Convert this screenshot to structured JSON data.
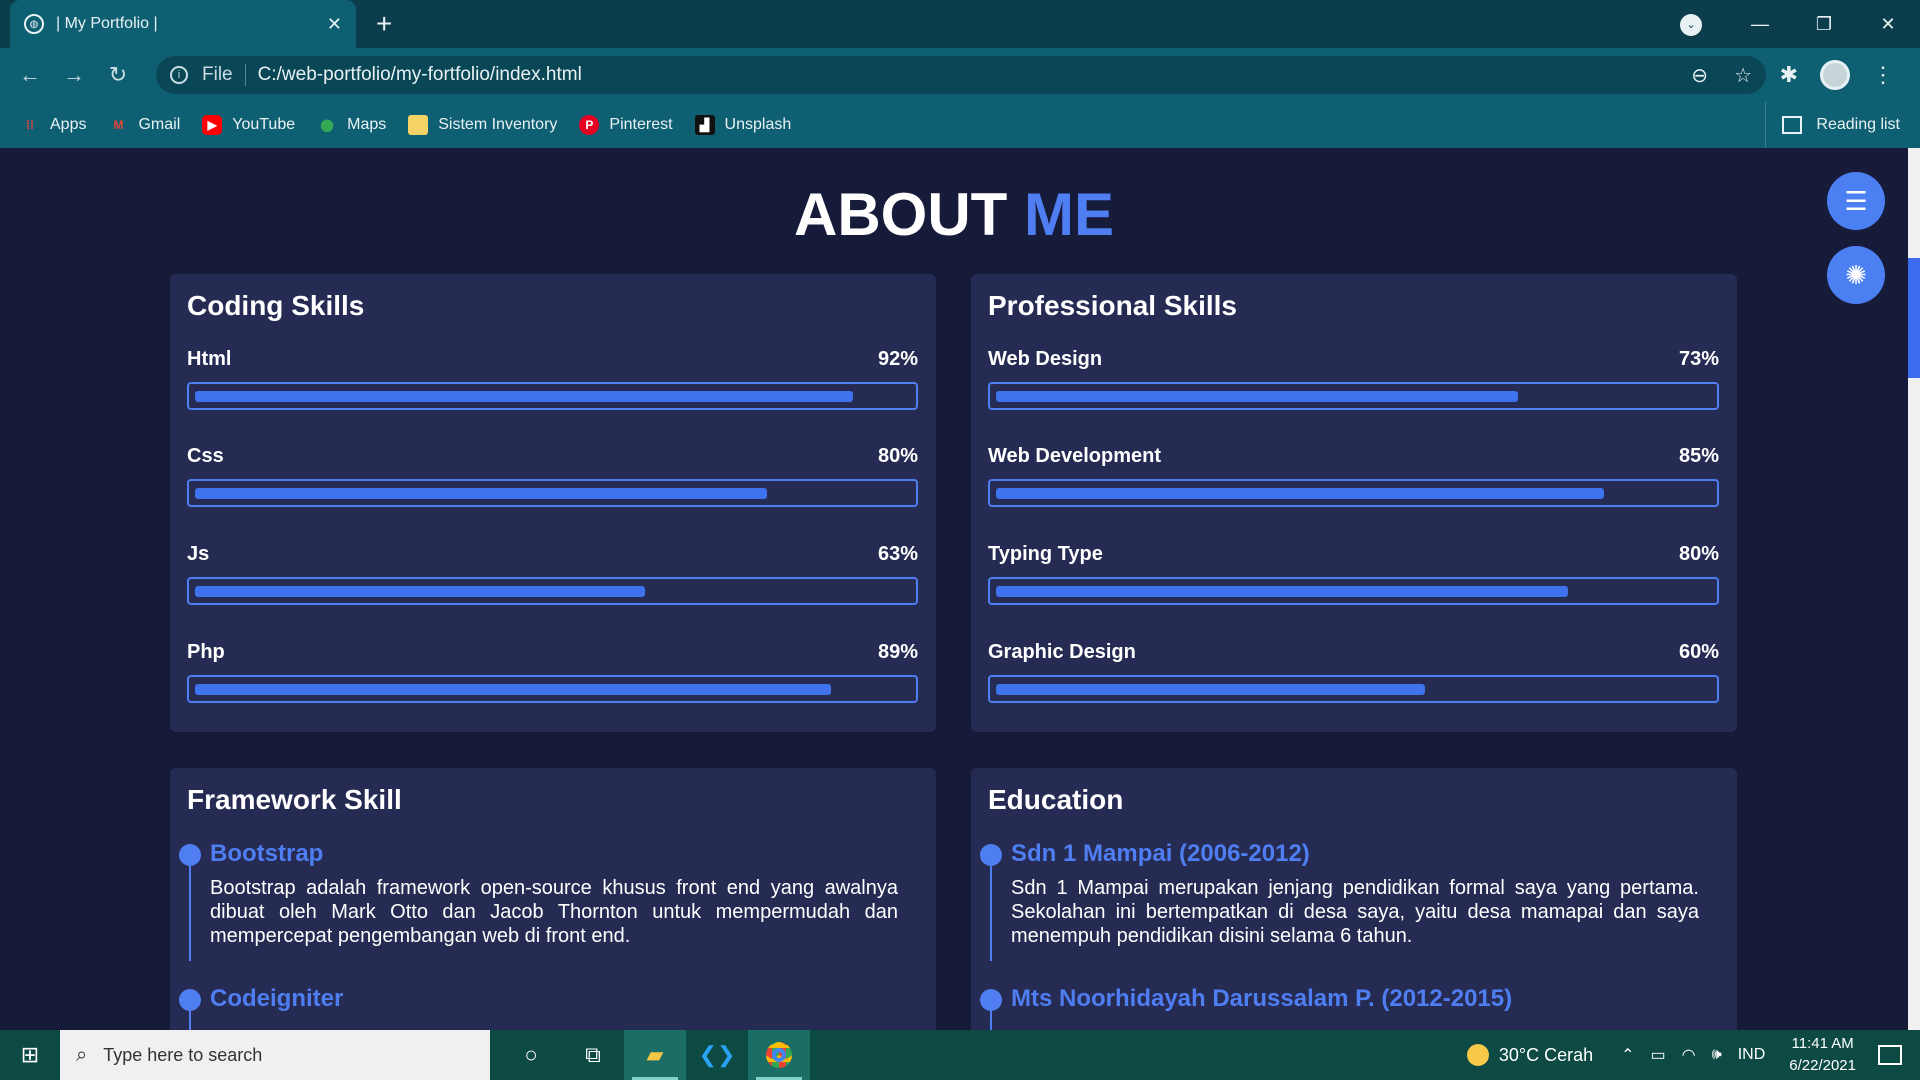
{
  "browser": {
    "tab_title": "| My Portfolio |",
    "tab_close": "✕",
    "new_tab": "+",
    "url_prefix": "File",
    "url": "C:/web-portfolio/my-fortfolio/index.html",
    "window_controls": [
      "⌄",
      "—",
      "❐",
      "✕"
    ],
    "bookmarks": [
      {
        "label": "Apps",
        "icon": "apps-grid-icon",
        "color": "#e8453c"
      },
      {
        "label": "Gmail",
        "icon": "gmail-icon",
        "color": "#ea4335"
      },
      {
        "label": "YouTube",
        "icon": "youtube-icon",
        "color": "#ff0000"
      },
      {
        "label": "Maps",
        "icon": "maps-pin-icon",
        "color": "#34a853"
      },
      {
        "label": "Sistem Inventory",
        "icon": "folder-icon",
        "color": "#f6d365"
      },
      {
        "label": "Pinterest",
        "icon": "pinterest-icon",
        "color": "#e60023"
      },
      {
        "label": "Unsplash",
        "icon": "unsplash-icon",
        "color": "#111111"
      }
    ],
    "reading_list": "Reading list"
  },
  "page": {
    "heading_main": "ABOUT",
    "heading_accent": "ME",
    "accent_color": "#4f7ef2",
    "coding": {
      "title": "Coding Skills",
      "skills": [
        {
          "name": "Html",
          "pct": "92%",
          "value": 92
        },
        {
          "name": "Css",
          "pct": "80%",
          "value": 80
        },
        {
          "name": "Js",
          "pct": "63%",
          "value": 63
        },
        {
          "name": "Php",
          "pct": "89%",
          "value": 89
        }
      ]
    },
    "professional": {
      "title": "Professional Skills",
      "skills": [
        {
          "name": "Web Design",
          "pct": "73%",
          "value": 73
        },
        {
          "name": "Web Development",
          "pct": "85%",
          "value": 85
        },
        {
          "name": "Typing Type",
          "pct": "80%",
          "value": 80
        },
        {
          "name": "Graphic Design",
          "pct": "60%",
          "value": 60
        }
      ]
    },
    "framework": {
      "title": "Framework Skill",
      "items": [
        {
          "title": "Bootstrap",
          "desc": "Bootstrap adalah framework open-source khusus front end yang awalnya dibuat oleh Mark Otto dan Jacob Thornton untuk mempermudah dan mempercepat pengembangan web di front end."
        },
        {
          "title": "Codeigniter",
          "desc": ""
        }
      ]
    },
    "education": {
      "title": "Education",
      "items": [
        {
          "title": "Sdn 1 Mampai (2006-2012)",
          "desc": "Sdn 1 Mampai merupakan jenjang pendidikan formal saya yang pertama. Sekolahan ini bertempatkan di desa saya, yaitu desa mamapai dan saya menempuh pendidikan disini selama 6 tahun."
        },
        {
          "title": "Mts Noorhidayah Darussalam P. (2012-2015)",
          "desc": ""
        }
      ]
    }
  },
  "taskbar": {
    "search_placeholder": "Type here to search",
    "weather": "30°C Cerah",
    "language": "IND",
    "time": "11:41 AM",
    "date": "6/22/2021"
  }
}
